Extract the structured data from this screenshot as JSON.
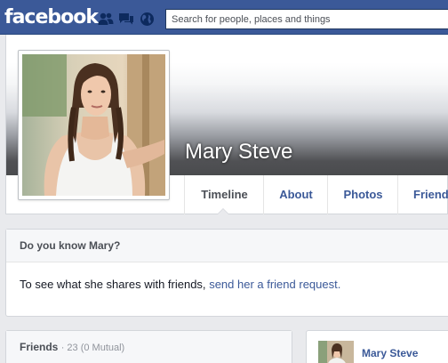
{
  "topbar": {
    "logo": "facebook",
    "search_placeholder": "Search for people, places and things",
    "icons": [
      "friend-requests-icon",
      "messages-icon",
      "notifications-globe-icon"
    ],
    "brand_color": "#3b5998"
  },
  "profile": {
    "name": "Mary Steve"
  },
  "tabs": [
    {
      "label": "Timeline",
      "active": true
    },
    {
      "label": "About",
      "active": false
    },
    {
      "label": "Photos",
      "active": false
    },
    {
      "label": "Friends",
      "active": false
    }
  ],
  "know_card": {
    "title": "Do you know Mary?",
    "text": "To see what she shares with friends,",
    "link": "send her a friend request."
  },
  "friends_card": {
    "title": "Friends",
    "count": "· 23 (0 Mutual)"
  },
  "right_card": {
    "name": "Mary Steve"
  }
}
